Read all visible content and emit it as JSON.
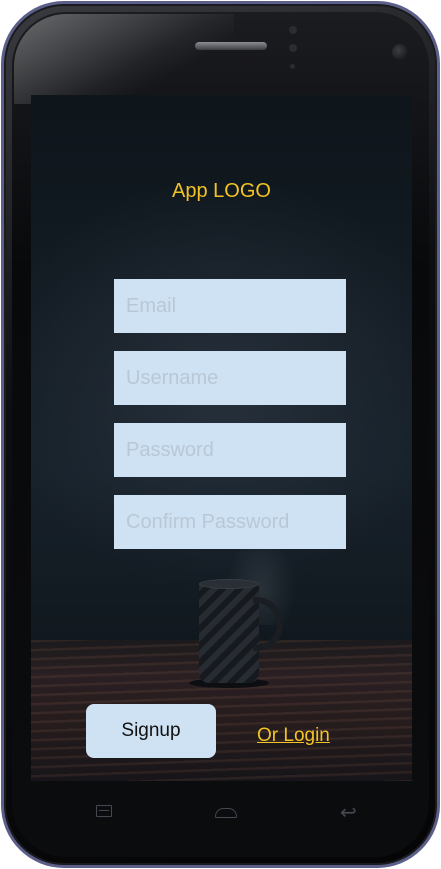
{
  "screen": {
    "logo_text": "App LOGO",
    "email": {
      "placeholder": "Email",
      "value": ""
    },
    "username": {
      "placeholder": "Username",
      "value": ""
    },
    "password": {
      "placeholder": "Password",
      "value": ""
    },
    "confirm_password": {
      "placeholder": "Confirm Password",
      "value": ""
    },
    "signup_label": "Signup",
    "login_link_label": "Or Login"
  },
  "nav_bar": {
    "menu_icon": "menu-icon",
    "home_icon": "home-icon",
    "back_icon": "back-icon",
    "back_glyph": "↩"
  },
  "colors": {
    "accent": "#f3c323",
    "field_background": "#cfe2f3",
    "screen_background": "#121a21"
  }
}
